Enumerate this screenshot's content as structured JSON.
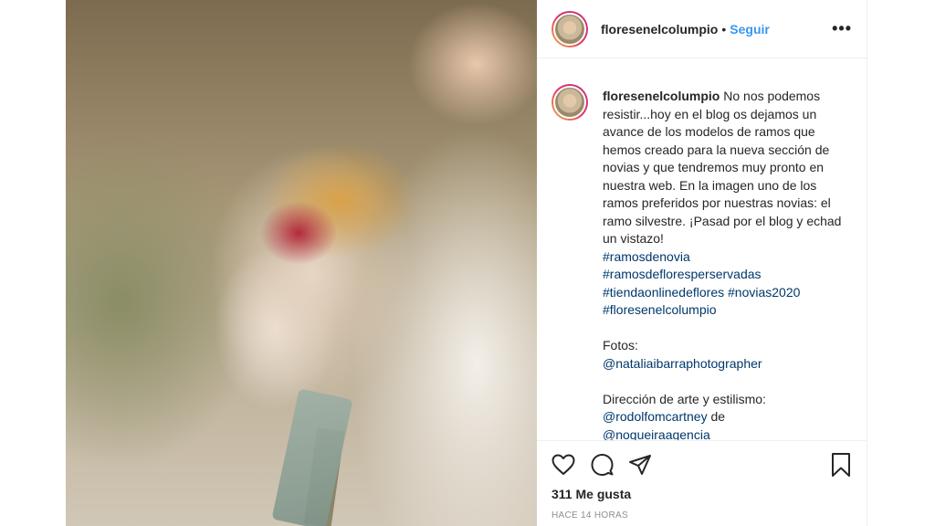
{
  "post": {
    "username": "floresenelcolumpio",
    "follow_label": "Seguir",
    "separator": "•",
    "more_icon": "more-horizontal-icon",
    "more_glyph": "•••"
  },
  "caption": {
    "username": "floresenelcolumpio",
    "text": "No nos podemos resistir...hoy en el blog os dejamos un avance de los modelos de ramos que hemos creado para la nueva sección de novias y que tendremos muy pronto en nuestra web. En la imagen uno de los ramos preferidos por nuestras novias: el ramo silvestre. ¡Pasad por el blog y echad un vistazo!",
    "hashtags": [
      "#ramosdenovia",
      "#ramosdefloresperservadas",
      "#tiendaonlinedeflores",
      "#novias2020",
      "#floresenelcolumpio"
    ],
    "photos_label": "Fotos:",
    "photographer": "@nataliaibarraphotographer",
    "art_label": "Dirección de arte y estilismo:",
    "art_handle": "@rodolfomcartney",
    "art_connector": "de",
    "art_handle2": "@nogueiraagencia"
  },
  "actions": {
    "icons": [
      "heart-icon",
      "comment-icon",
      "share-icon",
      "bookmark-icon"
    ]
  },
  "likes": "311 Me gusta",
  "timestamp": "HACE 14 HORAS",
  "colors": {
    "link": "#3897f0",
    "hashtag": "#00376b",
    "muted": "#8e8e8e"
  }
}
